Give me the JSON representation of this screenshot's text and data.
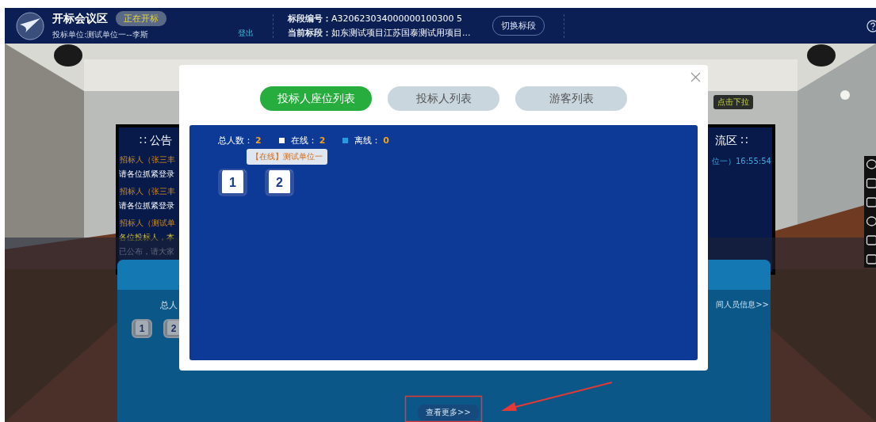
{
  "header": {
    "title": "开标会议区",
    "status_badge": "正在开标",
    "user": "投标单位:测试单位一--李斯",
    "logout": "登出",
    "section_no_label": "标段编号：",
    "section_no": "A320623034000000100300 5",
    "current_label": "当前标段：",
    "current": "如东测试项目江苏国泰测试用项目...",
    "switch_button": "切换标段"
  },
  "announcement_panel": {
    "title": "∷ 公告",
    "messages": [
      {
        "sender": "招标人（张三丰",
        "lines": [
          "请各位抓紧登录"
        ]
      },
      {
        "sender": "招标人（张三丰",
        "lines": [
          "请各位抓紧登录"
        ]
      },
      {
        "sender": "招标人（测试单",
        "lines": [
          "各位投标人，本",
          "已公布，请大家"
        ]
      }
    ]
  },
  "chat_panel": {
    "title": "流区 ∷",
    "message": "位一）16:55:54",
    "hint": "点击下拉"
  },
  "lower_panel": {
    "total_label": "总人",
    "seats": [
      "1",
      "2"
    ],
    "link": "间人员信息>>",
    "more_button": "查看更多>>"
  },
  "modal": {
    "tabs": [
      {
        "label": "投标人座位列表",
        "selected": true
      },
      {
        "label": "投标人列表",
        "selected": false
      },
      {
        "label": "游客列表",
        "selected": false
      }
    ],
    "stats": [
      {
        "kind": "total",
        "label": "总人数：",
        "value": "2"
      },
      {
        "kind": "online",
        "label": "在线：",
        "value": "2"
      },
      {
        "kind": "offline",
        "label": "离线：",
        "value": "0"
      }
    ],
    "seats": [
      {
        "number": "1",
        "online": true
      },
      {
        "number": "2",
        "online": true
      }
    ],
    "tooltip": "【在线】测试单位一"
  }
}
